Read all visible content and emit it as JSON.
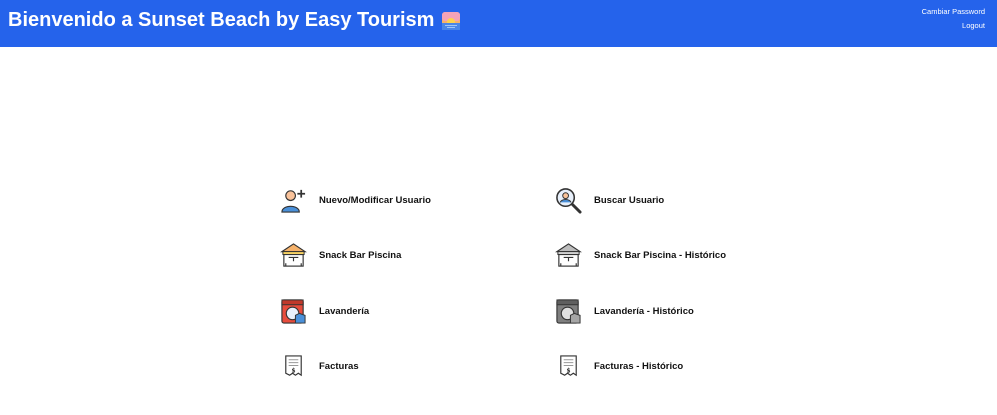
{
  "header": {
    "title": "Bienvenido a Sunset Beach by Easy Tourism",
    "title_icon": "sunset-icon",
    "links": {
      "change_password": "Cambiar Password",
      "logout": "Logout"
    },
    "background": "#2563eb"
  },
  "menu": {
    "items": [
      {
        "label": "Nuevo/Modificar Usuario",
        "icon": "add-user-icon"
      },
      {
        "label": "Buscar Usuario",
        "icon": "search-user-icon"
      },
      {
        "label": "Snack Bar Piscina",
        "icon": "snack-bar-icon"
      },
      {
        "label": "Snack Bar Piscina - Histórico",
        "icon": "snack-bar-history-icon"
      },
      {
        "label": "Lavandería",
        "icon": "laundry-icon"
      },
      {
        "label": "Lavandería - Histórico",
        "icon": "laundry-history-icon"
      },
      {
        "label": "Facturas",
        "icon": "invoice-icon"
      },
      {
        "label": "Facturas - Histórico",
        "icon": "invoice-history-icon"
      }
    ]
  }
}
